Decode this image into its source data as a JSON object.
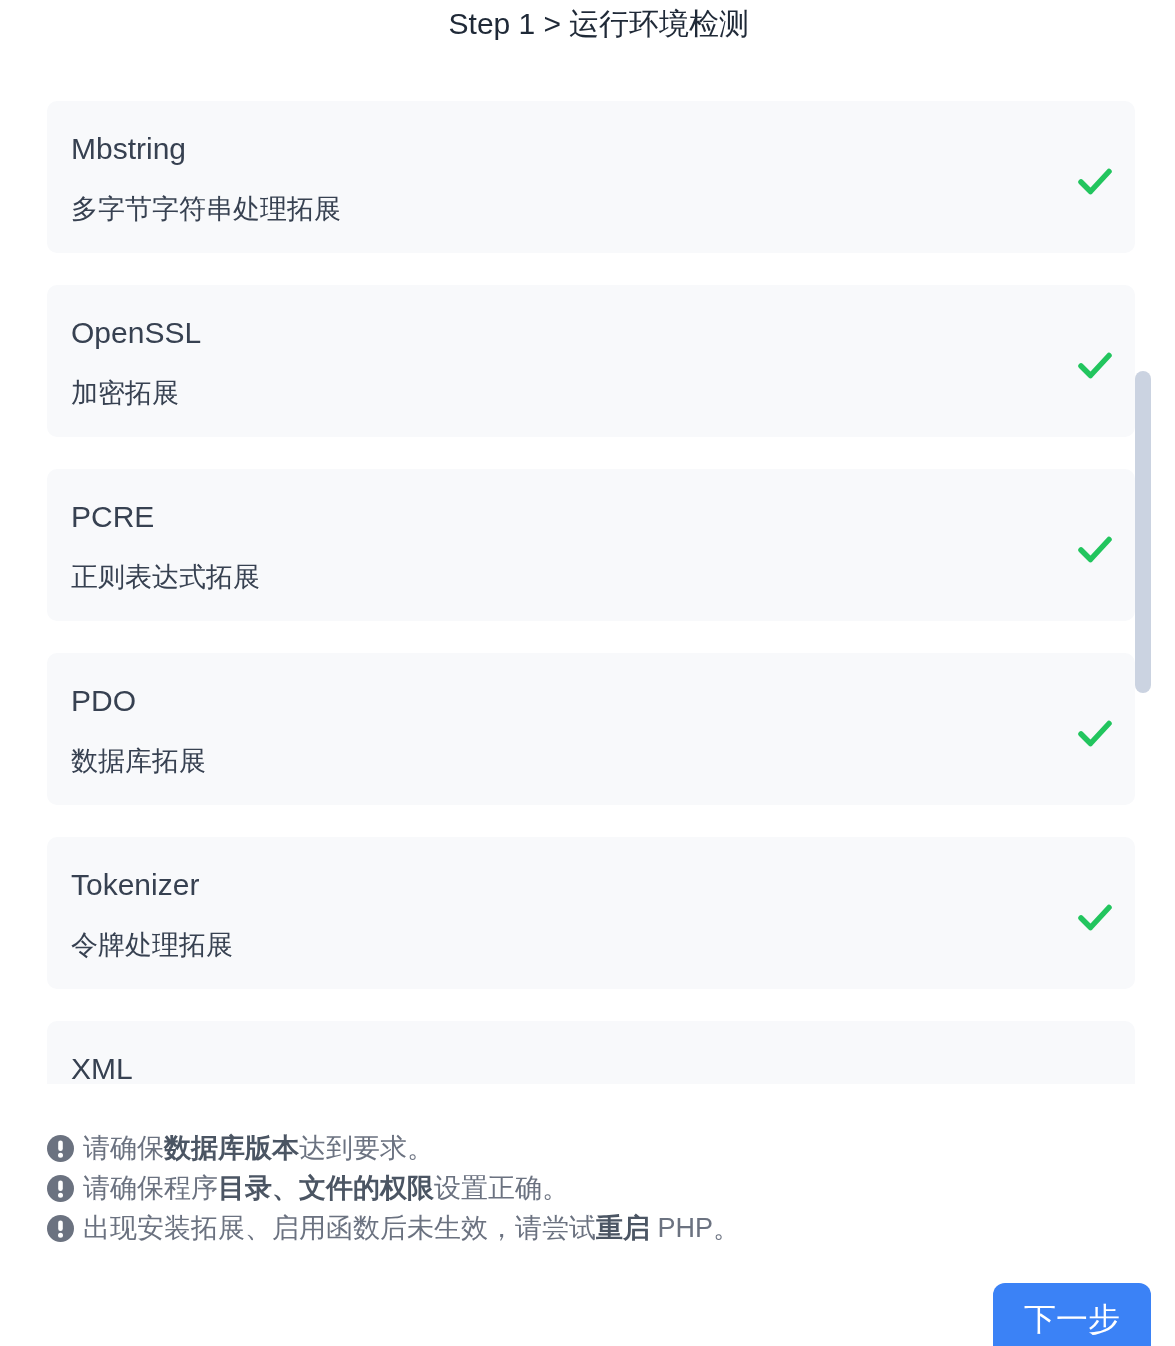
{
  "title": "Step 1 > 运行环境检测",
  "checks": [
    {
      "name": "Mbstring",
      "description": "多字节字符串处理拓展",
      "passed": true
    },
    {
      "name": "OpenSSL",
      "description": "加密拓展",
      "passed": true
    },
    {
      "name": "PCRE",
      "description": "正则表达式拓展",
      "passed": true
    },
    {
      "name": "PDO",
      "description": "数据库拓展",
      "passed": true
    },
    {
      "name": "Tokenizer",
      "description": "令牌处理拓展",
      "passed": true
    },
    {
      "name": "XML"
    }
  ],
  "notes": [
    "请确保**数据库版本**达到要求。",
    "请确保程序**目录、文件的权限**设置正确。",
    "出现安装拓展、启用函数后未生效，请尝试**重启** PHP。"
  ],
  "next_button": {
    "label": "下一步"
  }
}
